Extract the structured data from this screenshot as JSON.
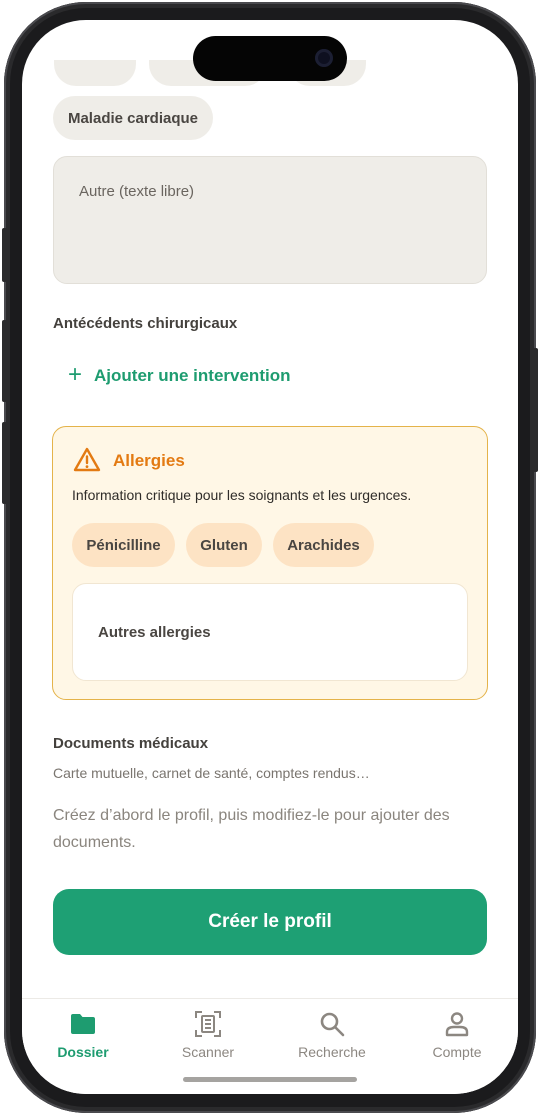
{
  "conditions": {
    "chip_label": "Maladie cardiaque",
    "other_placeholder": "Autre (texte libre)"
  },
  "surgical": {
    "label": "Antécédents chirurgicaux",
    "add_label": "Ajouter une intervention",
    "add_symbol": "+"
  },
  "allergies": {
    "title": "Allergies",
    "description": "Information critique pour les soignants et les urgences.",
    "chips": [
      "Pénicilline",
      "Gluten",
      "Arachides"
    ],
    "other_placeholder": "Autres allergies",
    "icon": "warning-triangle-icon",
    "accent_color": "#e37a12"
  },
  "documents": {
    "label": "Documents médicaux",
    "subtitle": "Carte mutuelle, carnet de santé, comptes rendus…",
    "info": "Créez d’abord le profil, puis modifiez-le pour ajouter des documents."
  },
  "cta": {
    "label": "Créer le profil",
    "color": "#1ea074"
  },
  "tabbar": {
    "tabs": [
      {
        "label": "Dossier",
        "icon": "folder-icon",
        "active": true
      },
      {
        "label": "Scanner",
        "icon": "scanner-icon",
        "active": false
      },
      {
        "label": "Recherche",
        "icon": "search-icon",
        "active": false
      },
      {
        "label": "Compte",
        "icon": "user-icon",
        "active": false
      }
    ]
  }
}
